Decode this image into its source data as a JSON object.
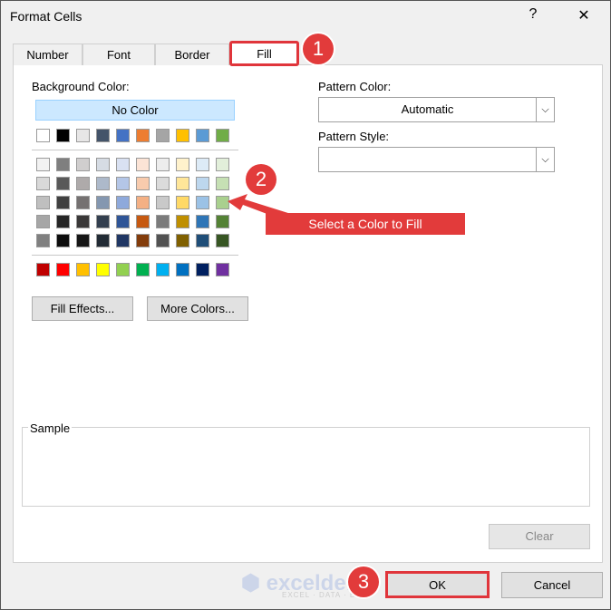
{
  "window": {
    "title": "Format Cells",
    "help": "?",
    "close": "✕"
  },
  "tabs": [
    "Number",
    "Font",
    "Border",
    "Fill"
  ],
  "background": {
    "label": "Background Color:",
    "no_color": "No Color",
    "theme_top": [
      "#ffffff",
      "#000000",
      "#e7e6e6",
      "#44546a",
      "#4472c4",
      "#ed7d31",
      "#a5a5a5",
      "#ffc000",
      "#5b9bd5",
      "#70ad47"
    ],
    "theme_rows": [
      [
        "#f2f2f2",
        "#7f7f7f",
        "#d0cece",
        "#d6dce4",
        "#d9e1f2",
        "#fce4d6",
        "#ededed",
        "#fff2cc",
        "#ddebf7",
        "#e2efda"
      ],
      [
        "#d9d9d9",
        "#595959",
        "#aeaaaa",
        "#adb9ca",
        "#b4c6e7",
        "#f8cbad",
        "#dbdbdb",
        "#ffe699",
        "#bdd7ee",
        "#c6e0b4"
      ],
      [
        "#bfbfbf",
        "#404040",
        "#757171",
        "#8497b0",
        "#8ea9db",
        "#f4b084",
        "#c9c9c9",
        "#ffd966",
        "#9bc2e6",
        "#a9d08e"
      ],
      [
        "#a6a6a6",
        "#262626",
        "#3a3838",
        "#333f4f",
        "#2f5597",
        "#c65911",
        "#7b7b7b",
        "#bf8f00",
        "#2e75b6",
        "#548235"
      ],
      [
        "#808080",
        "#0d0d0d",
        "#161616",
        "#222b35",
        "#203764",
        "#833c0b",
        "#525252",
        "#806000",
        "#1f4e78",
        "#375623"
      ]
    ],
    "standard": [
      "#c00000",
      "#ff0000",
      "#ffc000",
      "#ffff00",
      "#92d050",
      "#00b050",
      "#00b0f0",
      "#0070c0",
      "#002060",
      "#7030a0"
    ]
  },
  "pattern": {
    "color_label": "Pattern Color:",
    "color_value": "Automatic",
    "style_label": "Pattern Style:",
    "style_value": ""
  },
  "buttons": {
    "fill_effects": "Fill Effects...",
    "more_colors": "More Colors...",
    "clear": "Clear",
    "ok": "OK",
    "cancel": "Cancel"
  },
  "sample_label": "Sample",
  "annotations": {
    "step1": "1",
    "step2": "2",
    "step3": "3",
    "callout": "Select a Color to Fill",
    "accent": "#e23b3b"
  },
  "watermark": {
    "brand": "exceldemy",
    "tagline": "EXCEL · DATA · BI"
  }
}
